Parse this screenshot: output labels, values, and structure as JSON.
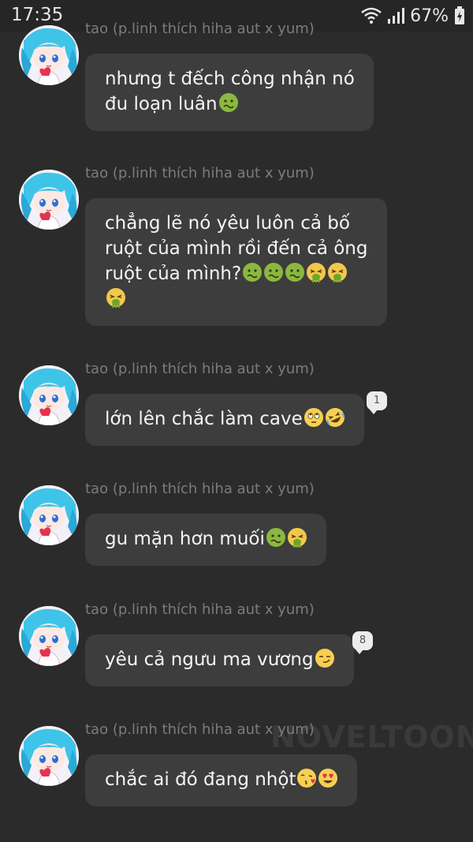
{
  "status": {
    "time": "17:35",
    "battery": "67%",
    "wifi_icon": "wifi-icon",
    "signal_icon": "signal-bars-icon",
    "battery_icon": "battery-charging-icon"
  },
  "watermark": "NOVELTOON",
  "messages": [
    {
      "sender": "tao (p.linh thích hiha aut x yum)",
      "lines": [
        "nhưng t đếch công nhận nó",
        "đu loạn luân"
      ],
      "emojis_after": [
        "nauseated-face"
      ]
    },
    {
      "sender": "tao (p.linh thích hiha aut x yum)",
      "lines": [
        "chẳng lẽ nó yêu luôn cả bố",
        "ruột của mình rồi đến cả ông",
        "ruột của mình?"
      ],
      "emojis_after": [
        "nauseated-face",
        "nauseated-face",
        "nauseated-face",
        "vomiting-face",
        "vomiting-face",
        "vomiting-face"
      ]
    },
    {
      "sender": "tao (p.linh thích hiha aut x yum)",
      "lines": [
        "lớn lên chắc làm cave"
      ],
      "emojis_after": [
        "eye-roll-face",
        "rofl-face"
      ],
      "badge": "1"
    },
    {
      "sender": "tao (p.linh thích hiha aut x yum)",
      "lines": [
        "gu mặn hơn muối"
      ],
      "emojis_after": [
        "nauseated-face",
        "vomiting-face"
      ]
    },
    {
      "sender": "tao (p.linh thích hiha aut x yum)",
      "lines": [
        "yêu cả ngưu ma vương"
      ],
      "emojis_after": [
        "smirk-face"
      ],
      "badge": "8"
    },
    {
      "sender": "tao (p.linh thích hiha aut x yum)",
      "lines": [
        "chắc ai đó đang nhột"
      ],
      "emojis_after": [
        "kiss-face",
        "heart-eyes-face"
      ]
    }
  ],
  "colors": {
    "background": "#2b2b2b",
    "bubble": "#3d3d3d",
    "sender_text": "#7c7c7c",
    "message_text": "#f5f5f5"
  }
}
